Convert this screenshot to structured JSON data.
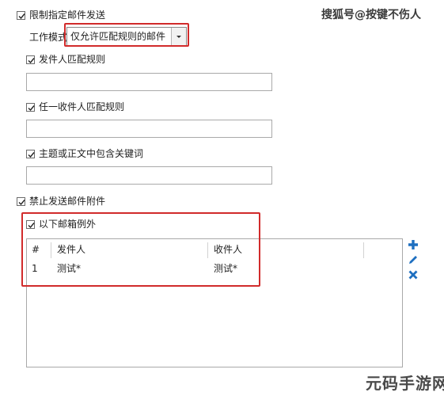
{
  "restrict_sending": {
    "label": "限制指定邮件发送",
    "checked": true
  },
  "work_mode": {
    "label": "工作模式",
    "value": "仅允许匹配规则的邮件"
  },
  "sender_rule": {
    "label": "发件人匹配规则",
    "checked": true,
    "value": ""
  },
  "recipient_rule": {
    "label": "任一收件人匹配规则",
    "checked": true,
    "value": ""
  },
  "keyword_rule": {
    "label": "主题或正文中包含关键词",
    "checked": true,
    "value": ""
  },
  "block_attachments": {
    "label": "禁止发送邮件附件",
    "checked": true
  },
  "exceptions": {
    "label": "以下邮箱例外",
    "checked": true,
    "columns": [
      "#",
      "发件人",
      "收件人"
    ],
    "rows": [
      {
        "num": "1",
        "sender": "测试*",
        "recipient": "测试*"
      }
    ]
  },
  "actions": {
    "add_icon": "plus-icon",
    "edit_icon": "pencil-icon",
    "delete_icon": "x-icon"
  },
  "watermark_top": "搜狐号@按键不伤人",
  "watermark_bottom": "元码手游网",
  "colors": {
    "highlight": "#d12b2b",
    "action_blue": "#1e6fc0"
  }
}
